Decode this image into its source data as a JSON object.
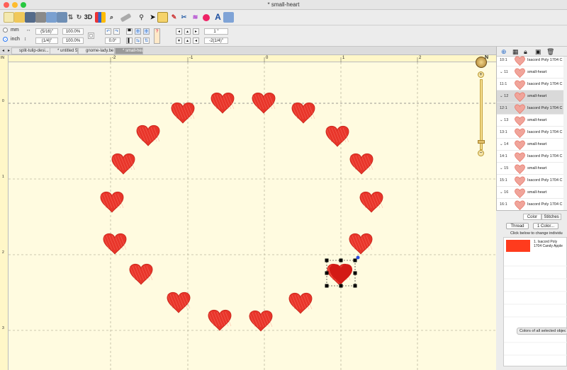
{
  "window": {
    "title": "* small-heart"
  },
  "toolbar": {
    "icons": [
      "new-icon",
      "open-icon",
      "save-icon",
      "print-icon",
      "copy-icon",
      "import-icon",
      "swap-icon",
      "reload-icon",
      "3d-view-icon",
      "chart-icon",
      "zoom-icon",
      "ruler-icon",
      "hoop-icon",
      "select-arrow-icon",
      "grid-icon",
      "stitch-icon",
      "color-picker-icon",
      "paint-icon",
      "text-icon",
      "export-icon"
    ],
    "label_3d": "3D"
  },
  "units": {
    "mm_label": "mm",
    "inch_label": "inch",
    "width_value": "(5/16)\"",
    "height_value": "(1/4)\"",
    "width_pct": "100.0%",
    "height_pct": "100.0%",
    "rotation": "0.0°",
    "move_x": "1 \"",
    "move_y": "-2(1/4)\""
  },
  "tabs": [
    {
      "label": "split-tulip-desi..."
    },
    {
      "label": "* untitled 5"
    },
    {
      "label": "gnome-lady.be"
    },
    {
      "label": "* small-heart"
    }
  ],
  "ruler": {
    "top_labels": [
      "-2",
      "-1",
      "0",
      "1",
      "2"
    ],
    "left_labels": [
      "IN",
      "0",
      "1",
      "2",
      "3"
    ]
  },
  "canvas": {
    "compass_label": "N"
  },
  "sequence": [
    {
      "num": "10:1",
      "text": "Isacord Poly 1704 C",
      "type": "color"
    },
    {
      "num": "11",
      "text": "small-heart",
      "type": "object"
    },
    {
      "num": "11:1",
      "text": "Isacord Poly 1704 C",
      "type": "color"
    },
    {
      "num": "12",
      "text": "small-heart",
      "type": "object",
      "selected": true
    },
    {
      "num": "12:1",
      "text": "Isacord Poly 1704 C",
      "type": "color",
      "selected": true
    },
    {
      "num": "13",
      "text": "small-heart",
      "type": "object"
    },
    {
      "num": "13:1",
      "text": "Isacord Poly 1704 C",
      "type": "color"
    },
    {
      "num": "14",
      "text": "small-heart",
      "type": "object"
    },
    {
      "num": "14:1",
      "text": "Isacord Poly 1704 C",
      "type": "color"
    },
    {
      "num": "15",
      "text": "small-heart",
      "type": "object"
    },
    {
      "num": "15:1",
      "text": "Isacord Poly 1704 C",
      "type": "color"
    },
    {
      "num": "16",
      "text": "small-heart",
      "type": "object"
    },
    {
      "num": "16:1",
      "text": "Isacord Poly 1704 C",
      "type": "color"
    }
  ],
  "color_panel": {
    "tab_color": "Color",
    "tab_stitches": "Stitches",
    "thread_button": "Thread",
    "one_color_button": "1 Color...",
    "instructions": "Click below to change individu",
    "swatch_line1": "1. Isacord Poly",
    "swatch_line2": "1704 Candy Apple",
    "swatch_color": "#ff3b1d",
    "footer": "Colors of all selected objec"
  },
  "colors": {
    "heart": "#e8352a",
    "heart_selected": "#d31a15",
    "canvas_bg": "#fffbe0"
  }
}
